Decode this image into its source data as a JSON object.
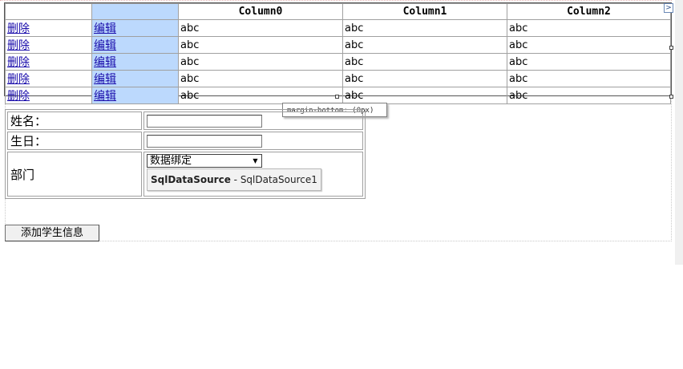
{
  "grid": {
    "columns": [
      "",
      "",
      "Column0",
      "Column1",
      "Column2"
    ],
    "rows": [
      {
        "delete": "删除",
        "edit": "编辑",
        "c0": "abc",
        "c1": "abc",
        "c2": "abc"
      },
      {
        "delete": "删除",
        "edit": "编辑",
        "c0": "abc",
        "c1": "abc",
        "c2": "abc"
      },
      {
        "delete": "删除",
        "edit": "编辑",
        "c0": "abc",
        "c1": "abc",
        "c2": "abc"
      },
      {
        "delete": "删除",
        "edit": "编辑",
        "c0": "abc",
        "c1": "abc",
        "c2": "abc"
      },
      {
        "delete": "删除",
        "edit": "编辑",
        "c0": "abc",
        "c1": "abc",
        "c2": "abc"
      }
    ],
    "smart_tag_glyph": ">",
    "selection_color": "#bcd9fd"
  },
  "tooltip": "margin-bottom: (0px)",
  "form": {
    "name_label": "姓名：",
    "birthday_label": "生日：",
    "dept_label": "部门",
    "name_value": "",
    "birthday_value": "",
    "dept_select": "数据绑定",
    "datasource_type": "SqlDataSource",
    "datasource_sep": " - ",
    "datasource_id": "SqlDataSource1"
  },
  "add_button": "添加学生信息"
}
